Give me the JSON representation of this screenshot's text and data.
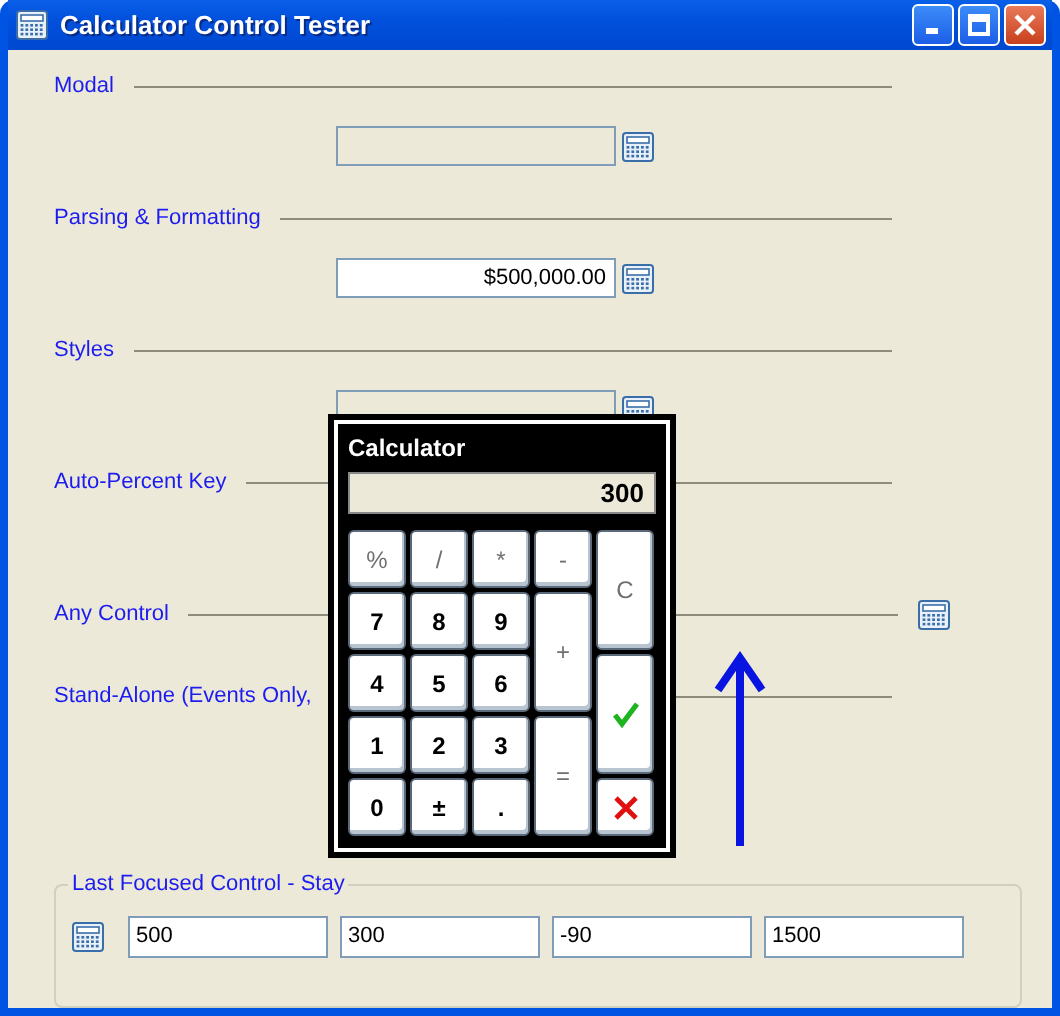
{
  "window": {
    "title": "Calculator Control Tester"
  },
  "sections": [
    {
      "label": "Modal",
      "kind": "field",
      "disabled": true
    },
    {
      "label": "Parsing & Formatting",
      "kind": "field",
      "value": "$500,000.00",
      "disabled": false
    },
    {
      "label": "Styles",
      "kind": "field",
      "disabled": true
    },
    {
      "label": "Auto-Percent Key",
      "kind": "plain"
    },
    {
      "label": "Any Control",
      "kind": "icon"
    },
    {
      "label": "Stand-Alone (Events Only,",
      "kind": "plain"
    }
  ],
  "group": {
    "legend": "Last Focused Control - Stay",
    "fields": [
      "500",
      "300",
      "-90",
      "1500"
    ]
  },
  "calculator": {
    "title": "Calculator",
    "display": "300",
    "keys": [
      {
        "label": "%",
        "kind": "op",
        "tall": false
      },
      {
        "label": "/",
        "kind": "op",
        "tall": false
      },
      {
        "label": "*",
        "kind": "op",
        "tall": false
      },
      {
        "label": "-",
        "kind": "op",
        "tall": false
      },
      {
        "label": "C",
        "kind": "op",
        "tall": true
      },
      {
        "label": "7",
        "kind": "digit",
        "tall": false
      },
      {
        "label": "8",
        "kind": "digit",
        "tall": false
      },
      {
        "label": "9",
        "kind": "digit",
        "tall": false
      },
      {
        "label": "+",
        "kind": "op",
        "tall": true
      },
      {
        "label": "4",
        "kind": "digit",
        "tall": false
      },
      {
        "label": "5",
        "kind": "digit",
        "tall": false
      },
      {
        "label": "6",
        "kind": "digit",
        "tall": false
      },
      {
        "kind": "ok",
        "tall": true
      },
      {
        "label": "1",
        "kind": "digit",
        "tall": false
      },
      {
        "label": "2",
        "kind": "digit",
        "tall": false
      },
      {
        "label": "3",
        "kind": "digit",
        "tall": false
      },
      {
        "label": "=",
        "kind": "op",
        "tall": true
      },
      {
        "label": "0",
        "kind": "digit",
        "tall": false
      },
      {
        "label": "±",
        "kind": "digit",
        "tall": false
      },
      {
        "label": ".",
        "kind": "digit",
        "tall": false
      },
      {
        "kind": "cancel",
        "tall": false
      }
    ]
  }
}
